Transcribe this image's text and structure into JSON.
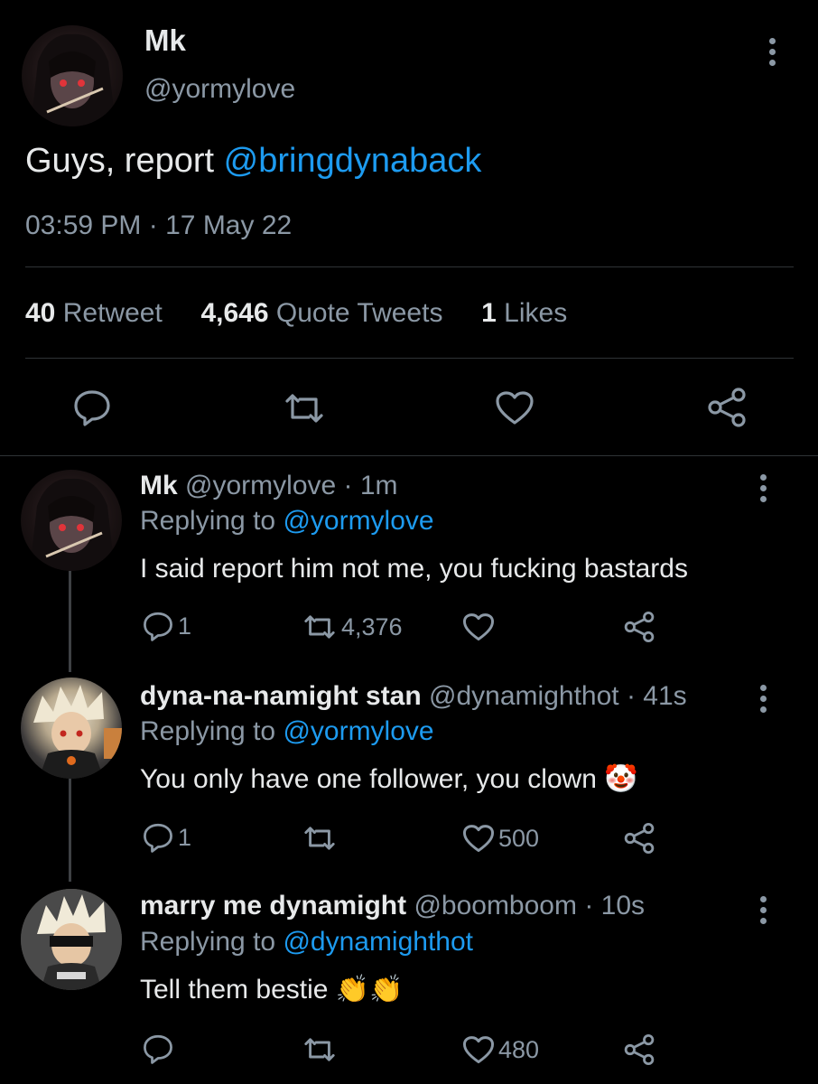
{
  "main_tweet": {
    "display_name": "Mk",
    "handle": "@yormylove",
    "text_prefix": "Guys, report ",
    "mention": "@bringdynaback",
    "time": "03:59 PM",
    "dot": "·",
    "date": "17 May 22",
    "stats": [
      {
        "count": "40",
        "label": "Retweet"
      },
      {
        "count": "4,646",
        "label": "Quote Tweets"
      },
      {
        "count": "1",
        "label": "Likes"
      }
    ],
    "icons": {
      "reply": "reply-icon",
      "retweet": "retweet-icon",
      "like": "heart-icon",
      "share": "share-icon"
    }
  },
  "replies": [
    {
      "display_name": "Mk",
      "handle": "@yormylove",
      "age": "· 1m",
      "replying_prefix": "Replying to ",
      "replying_to": "@yormylove",
      "text": "I said report him not me, you fucking bastards",
      "emoji": "",
      "reply_count": "1",
      "retweet_count": "4,376",
      "like_count": ""
    },
    {
      "display_name": "dyna-na-namight stan",
      "handle": "@dynamighthot",
      "age": "· 41s",
      "replying_prefix": "Replying to ",
      "replying_to": "@yormylove",
      "text": "You only have one follower, you clown ",
      "emoji": "🤡",
      "reply_count": "1",
      "retweet_count": "",
      "like_count": "500"
    },
    {
      "display_name": "marry me dynamight",
      "handle": "@boomboom",
      "age": "· 10s",
      "replying_prefix": "Replying to ",
      "replying_to": "@dynamighthot",
      "text": "Tell them bestie ",
      "emoji": "👏👏",
      "reply_count": "",
      "retweet_count": "",
      "like_count": "480"
    }
  ],
  "colors": {
    "background": "#000000",
    "text": "#e7e9ea",
    "muted": "#8b98a5",
    "link": "#1d9bf0",
    "divider": "#2f3336"
  }
}
